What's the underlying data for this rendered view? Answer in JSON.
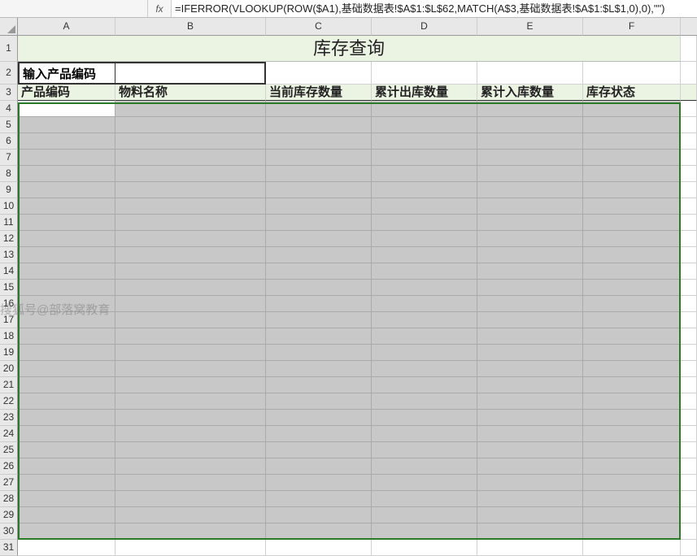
{
  "formula_bar": {
    "fx_label": "fx",
    "formula": "=IFERROR(VLOOKUP(ROW($A1),基础数据表!$A$1:$L$62,MATCH(A$3,基础数据表!$A$1:$L$1,0),0),\"\")"
  },
  "watermark": "搜狐号@部落窝教育",
  "columns": [
    "A",
    "B",
    "C",
    "D",
    "E",
    "F"
  ],
  "row_count": 31,
  "title": "库存查询",
  "input_label": "输入产品编码",
  "input_value": "",
  "headers": {
    "col_a": "产品编码",
    "col_b": "物料名称",
    "col_c": "当前库存数量",
    "col_d": "累计出库数量",
    "col_e": "累计入库数量",
    "col_f": "库存状态"
  },
  "active_cell": "A4"
}
